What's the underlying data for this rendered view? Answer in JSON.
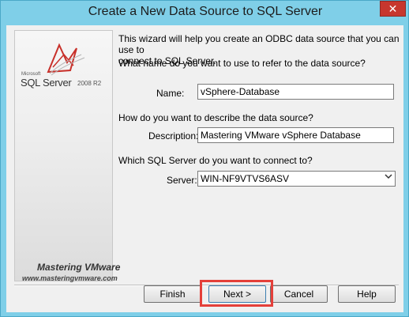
{
  "window": {
    "title": "Create a New Data Source to SQL Server",
    "close_glyph": "✕"
  },
  "side_panel": {
    "logo_small": "Microsoft",
    "logo_main": "SQL Server",
    "logo_version": "2008 R2",
    "watermark_title": "Mastering VMware",
    "watermark_url": "www.masteringvmware.com"
  },
  "form": {
    "intro": "This wizard will help you create an ODBC data source that you can use to\nconnect to SQL Server.",
    "name_question": "What name do you want to use to refer to the data source?",
    "name_label": "Name:",
    "name_value": "vSphere-Database",
    "desc_question": "How do you want to describe the data source?",
    "desc_label": "Description:",
    "desc_value": "Mastering VMware vSphere Database",
    "server_question": "Which SQL Server do you want to connect to?",
    "server_label": "Server:",
    "server_value": "WIN-NF9VTVS6ASV"
  },
  "buttons": {
    "finish": "Finish",
    "next": "Next >",
    "cancel": "Cancel",
    "help": "Help"
  },
  "colors": {
    "highlight": "#e4403a",
    "titlebar": "#7fcfe8",
    "close": "#c7372e"
  },
  "icons": {
    "logo": "sql-server-logo",
    "dropdown": "chevron-down-icon",
    "close": "close-icon"
  }
}
